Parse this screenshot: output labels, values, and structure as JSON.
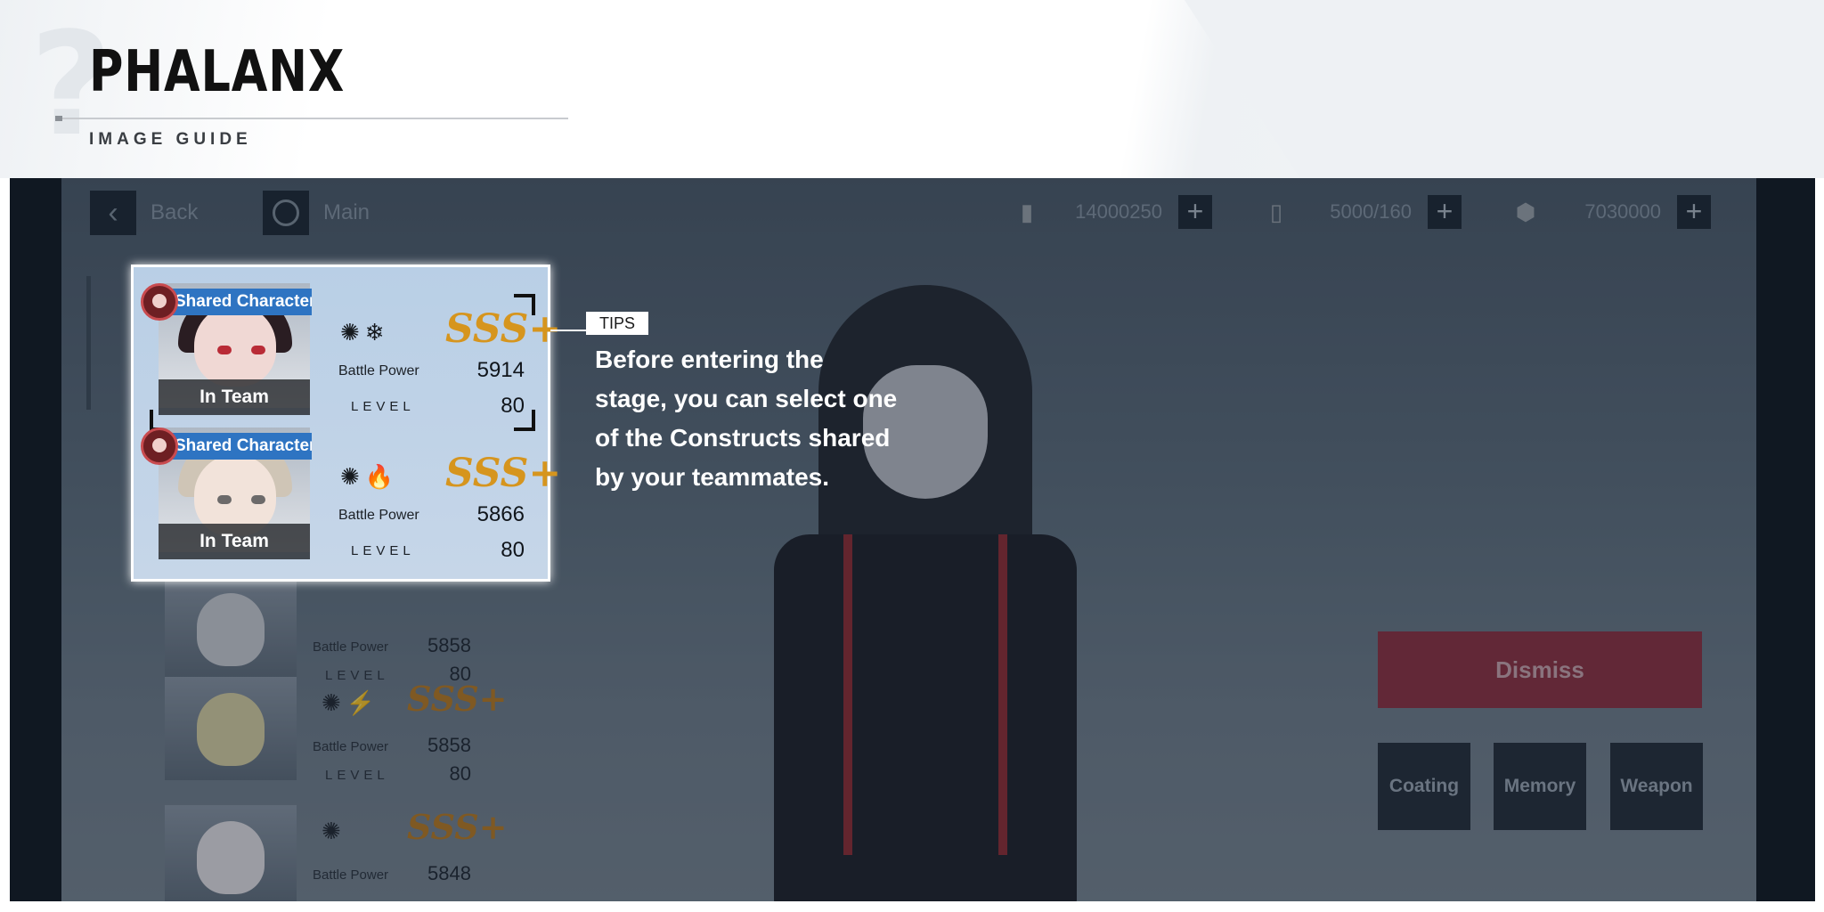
{
  "guide": {
    "title": "PHALANX",
    "subtitle": "IMAGE GUIDE"
  },
  "topbar": {
    "back_label": "Back",
    "main_label": "Main",
    "resources": [
      {
        "icon": "stamina-battery-icon",
        "value": "14000250"
      },
      {
        "icon": "serum-icon",
        "value": "5000/160"
      },
      {
        "icon": "cog-coin-icon",
        "value": "7030000"
      }
    ]
  },
  "highlight": {
    "cards": [
      {
        "tag": "Shared Character",
        "status": "In Team",
        "elements": "physical-icon snowflake-icon",
        "rank": "SSS+",
        "bp_label": "Battle Power",
        "bp_value": "5914",
        "level_label": "LEVEL",
        "level_value": "80"
      },
      {
        "tag": "Shared Character",
        "status": "In Team",
        "elements": "physical-icon flame-icon",
        "rank": "SSS+",
        "bp_label": "Battle Power",
        "bp_value": "5866",
        "level_label": "LEVEL",
        "level_value": "80"
      }
    ]
  },
  "tips": {
    "label": "TIPS",
    "text": "Before entering the stage, you can select one of the Constructs shared by your teammates."
  },
  "list": {
    "rows": [
      {
        "bp_label": "Battle Power",
        "bp_value": "5858",
        "level_label": "LEVEL",
        "level_value": "80"
      },
      {
        "bp_label": "Battle Power",
        "bp_value": "5858",
        "level_label": "LEVEL",
        "level_value": "80",
        "elements": "physical-icon lightning-icon",
        "rank": "SSS+"
      },
      {
        "bp_label": "Battle Power",
        "bp_value": "5848",
        "elements": "physical-icon",
        "rank": "SSS+"
      }
    ]
  },
  "actions": {
    "dismiss": "Dismiss",
    "coating": "Coating",
    "memory": "Memory",
    "weapon": "Weapon"
  },
  "colors": {
    "shared_tag": "#2e74c2",
    "dismiss": "#8c2f3e",
    "rank_gold": "#d6951e"
  }
}
